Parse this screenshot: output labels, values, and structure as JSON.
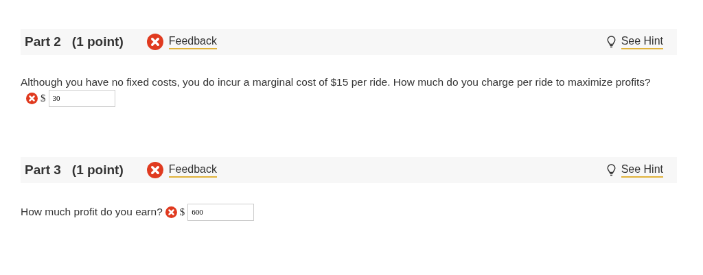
{
  "parts": [
    {
      "title": "Part 2",
      "points": "(1 point)",
      "correct": false,
      "feedback": "Feedback",
      "hint": "See Hint",
      "question": "Although you have no fixed costs, you do incur a marginal cost of $15 per ride. How much do you charge per ride to maximize profits?",
      "kind": "block",
      "answer": {
        "correct": false,
        "unit": "$",
        "value": "30"
      }
    },
    {
      "title": "Part 3",
      "points": "(1 point)",
      "correct": false,
      "feedback": "Feedback",
      "hint": "See Hint",
      "question": "How much profit do you earn?",
      "kind": "inline",
      "answer": {
        "correct": false,
        "unit": "$",
        "value": "600"
      }
    }
  ]
}
